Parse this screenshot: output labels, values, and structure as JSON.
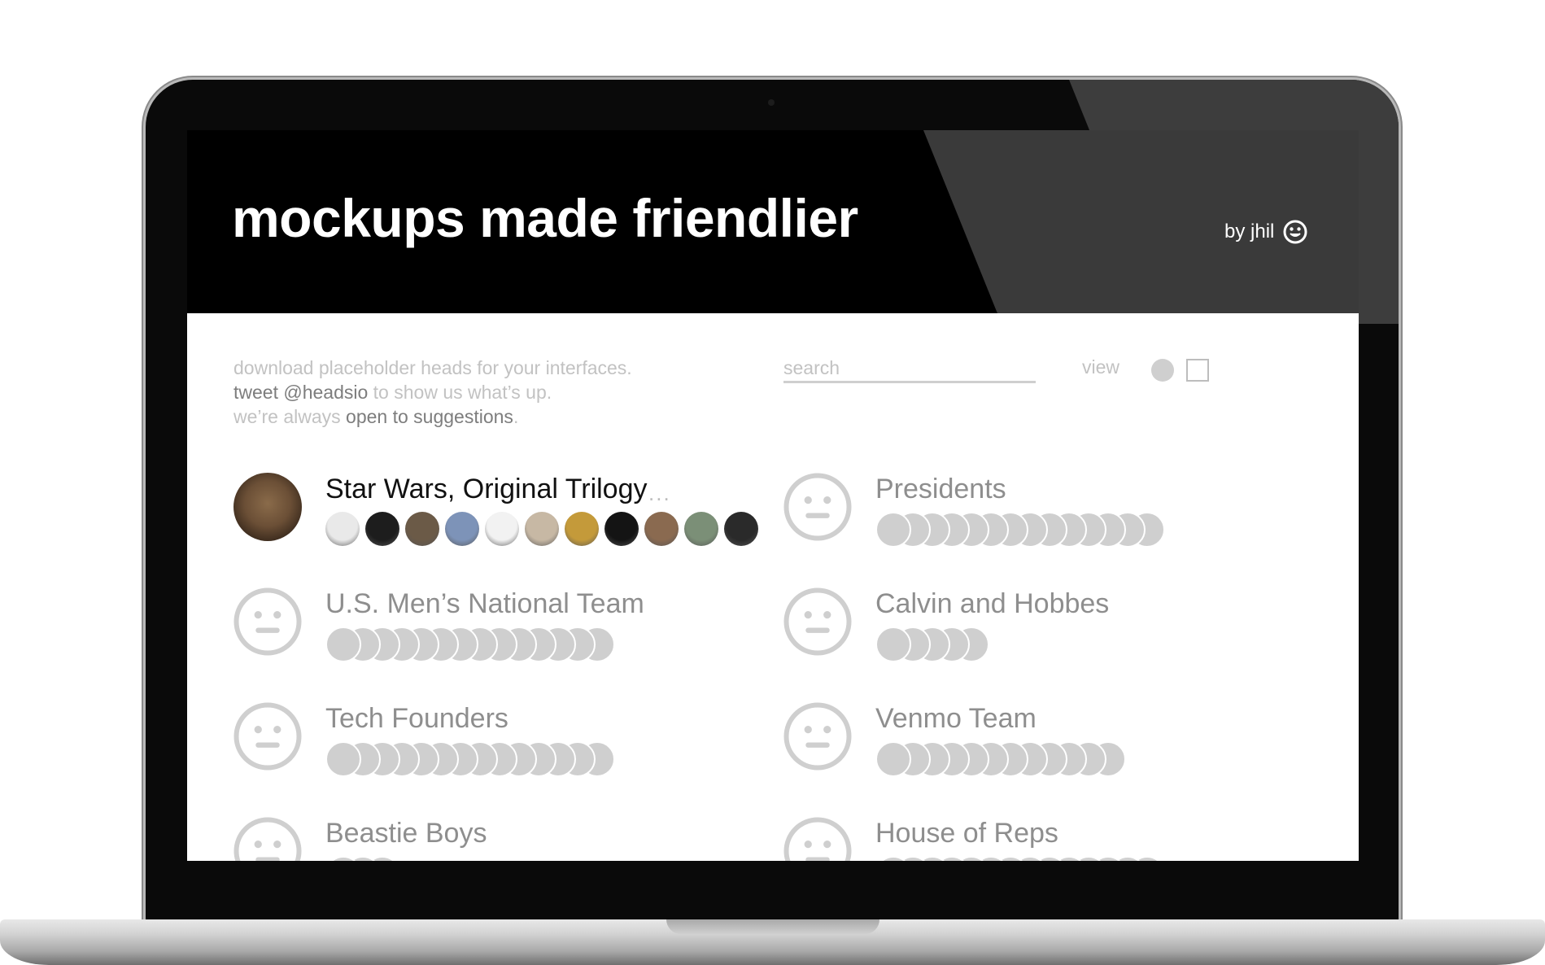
{
  "header": {
    "title": "mockups made friendlier",
    "byline": "by jhil",
    "byline_icon": "smiley-icon"
  },
  "intro": {
    "line1": "download placeholder heads for your interfaces.",
    "line2_em": "tweet @headsio",
    "line2_rest": " to show us what’s up.",
    "line3_start": "we’re always ",
    "line3_em": "open to suggestions",
    "line3_end": "."
  },
  "search": {
    "placeholder": "search",
    "value": ""
  },
  "view": {
    "label": "view",
    "options": [
      "round-view-icon",
      "square-view-icon"
    ],
    "selected": "round-view-icon"
  },
  "colors": {
    "accent_dark": "#000000",
    "muted": "#c2c2c2",
    "placeholder_gray": "#cfcfcf",
    "text_gray": "#8e8e8e"
  },
  "collections": [
    {
      "name": "Star Wars, Original Trilogy",
      "heads": 11,
      "more": "...",
      "active": true
    },
    {
      "name": "Presidents",
      "heads": 14,
      "active": false
    },
    {
      "name": "U.S. Men’s National Team",
      "heads": 14,
      "active": false
    },
    {
      "name": "Calvin and Hobbes",
      "heads": 5,
      "active": false
    },
    {
      "name": "Tech Founders",
      "heads": 14,
      "active": false
    },
    {
      "name": "Venmo Team",
      "heads": 12,
      "active": false
    },
    {
      "name": "Beastie Boys",
      "heads": 3,
      "active": false
    },
    {
      "name": "House of Reps",
      "heads": 14,
      "active": false
    }
  ]
}
